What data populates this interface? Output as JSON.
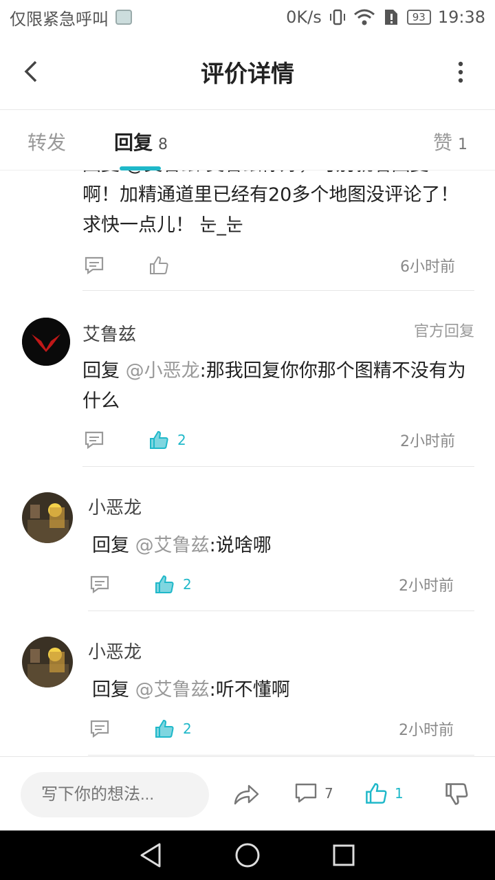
{
  "status_bar": {
    "carrier": "仅限紧急呼叫",
    "speed": "0K/s",
    "battery": "93",
    "time": "19:38"
  },
  "header": {
    "title": "评价详情"
  },
  "tabs": [
    {
      "label": "转发",
      "count": ""
    },
    {
      "label": "回复",
      "count": "8"
    },
    {
      "label": "赞",
      "count": "1"
    }
  ],
  "partial_comment": {
    "lines": [
      "回复 @艾鲁兹:艾鲁兹你好，可别就看回复",
      "啊！加精通道里已经有20多个地图没评论了！",
      "求快一点儿！ 눈_눈"
    ],
    "time": "6小时前"
  },
  "comments": [
    {
      "user": "艾鲁兹",
      "badge": "官方回复",
      "prefix": "回复 ",
      "mention": "@小恶龙",
      "text": ":那我回复你你那个图精不没有为什么",
      "likes": "2",
      "time": "2小时前"
    },
    {
      "user": "小恶龙",
      "badge": "",
      "prefix": "回复 ",
      "mention": "@艾鲁兹",
      "text": ":说啥哪",
      "likes": "2",
      "time": "2小时前"
    },
    {
      "user": "小恶龙",
      "badge": "",
      "prefix": "回复 ",
      "mention": "@艾鲁兹",
      "text": ":听不懂啊",
      "likes": "2",
      "time": "2小时前"
    }
  ],
  "bottom_bar": {
    "input_placeholder": "写下你的想法...",
    "comment_count": "7",
    "like_count": "1"
  },
  "colors": {
    "accent": "#1fb8c9"
  }
}
